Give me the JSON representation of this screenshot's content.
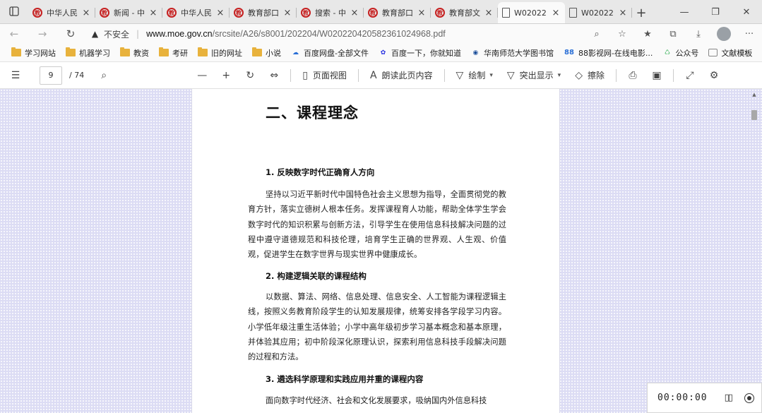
{
  "tabs": [
    {
      "title": "中华人民",
      "icon": "moe-emblem-icon",
      "active": false
    },
    {
      "title": "新闻 - 中",
      "icon": "moe-emblem-icon",
      "active": false
    },
    {
      "title": "中华人民",
      "icon": "moe-emblem-icon",
      "active": false
    },
    {
      "title": "教育部口",
      "icon": "moe-emblem-icon",
      "active": false
    },
    {
      "title": "搜索 - 中",
      "icon": "moe-emblem-icon",
      "active": false
    },
    {
      "title": "教育部口",
      "icon": "moe-emblem-icon",
      "active": false
    },
    {
      "title": "教育部文",
      "icon": "moe-emblem-icon",
      "active": false
    },
    {
      "title": "W02022",
      "icon": "document-icon",
      "active": true
    },
    {
      "title": "W02022",
      "icon": "document-icon",
      "active": false
    }
  ],
  "address": {
    "security_label": "不安全",
    "host": "www.moe.gov.cn",
    "path": "/srcsite/A26/s8001/202204/W020220420582361024968.pdf"
  },
  "bookmarks": [
    {
      "label": "学习网站",
      "icon": "folder-icon"
    },
    {
      "label": "机器学习",
      "icon": "folder-icon"
    },
    {
      "label": "教资",
      "icon": "folder-icon"
    },
    {
      "label": "考研",
      "icon": "folder-icon"
    },
    {
      "label": "旧的网址",
      "icon": "folder-icon"
    },
    {
      "label": "小说",
      "icon": "folder-icon"
    },
    {
      "label": "百度网盘-全部文件",
      "icon": "baidu-pan-icon"
    },
    {
      "label": "百度一下，你就知道",
      "icon": "baidu-paw-icon"
    },
    {
      "label": "华南师范大学图书馆",
      "icon": "scnu-icon"
    },
    {
      "label": "88影视网-在线电影...",
      "icon": "88-icon"
    },
    {
      "label": "公众号",
      "icon": "wechat-icon"
    },
    {
      "label": "文献模板",
      "icon": "page-icon"
    }
  ],
  "pdf_toolbar": {
    "page_current": "9",
    "page_total": "/ 74",
    "page_view": "页面视图",
    "read_aloud": "朗读此页内容",
    "draw": "绘制",
    "highlight": "突出显示",
    "erase": "擦除"
  },
  "document": {
    "heading": "二、课程理念",
    "sections": [
      {
        "title": "1.  反映数字时代正确育人方向",
        "body": "坚持以习近平新时代中国特色社会主义思想为指导，全面贯彻党的教育方针，落实立德树人根本任务。发挥课程育人功能，帮助全体学生学会数字时代的知识积累与创新方法，引导学生在使用信息科技解决问题的过程中遵守道德规范和科技伦理，培育学生正确的世界观、人生观、价值观，促进学生在数字世界与现实世界中健康成长。"
      },
      {
        "title": "2.  构建逻辑关联的课程结构",
        "body": "以数据、算法、网络、信息处理、信息安全、人工智能为课程逻辑主线，按照义务教育阶段学生的认知发展规律，统筹安排各学段学习内容。小学低年级注重生活体验；小学中高年级初步学习基本概念和基本原理，并体验其应用；初中阶段深化原理认识，探索利用信息科技手段解决问题的过程和方法。"
      },
      {
        "title": "3.  遴选科学原理和实践应用并重的课程内容",
        "body": "面向数字时代经济、社会和文化发展要求，吸纳国内外信息科技"
      }
    ]
  },
  "recorder": {
    "time": "00:00:00"
  }
}
